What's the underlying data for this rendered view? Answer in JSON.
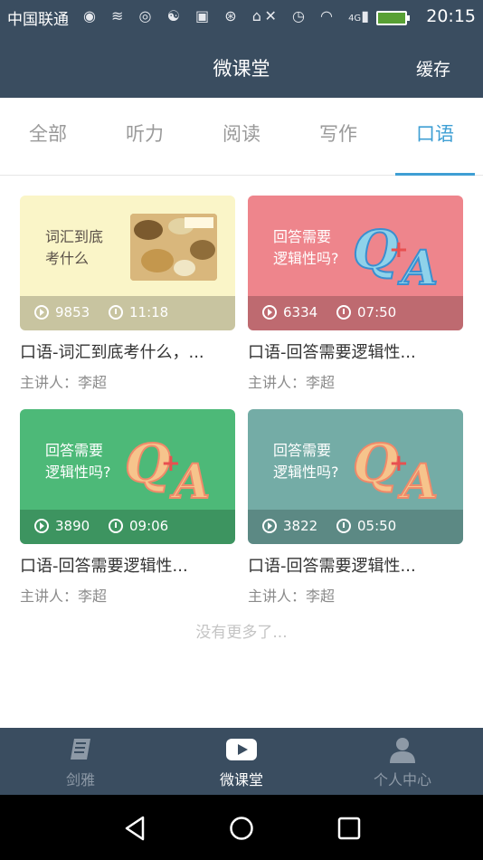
{
  "status": {
    "carrier": "中国联通",
    "network": "4G",
    "time": "20:15"
  },
  "header": {
    "title": "微课堂",
    "cache_label": "缓存"
  },
  "tabs": [
    {
      "label": "全部",
      "active": false
    },
    {
      "label": "听力",
      "active": false
    },
    {
      "label": "阅读",
      "active": false
    },
    {
      "label": "写作",
      "active": false
    },
    {
      "label": "口语",
      "active": true
    }
  ],
  "courses": [
    {
      "thumb_text": [
        "词汇到底",
        "考什么"
      ],
      "thumb_color": "#faf5c8",
      "plays": "9853",
      "duration": "11:18",
      "title": "口语-词汇到底考什么，...",
      "lecturer": "主讲人：李超"
    },
    {
      "thumb_text": [
        "回答需要",
        "逻辑性吗?"
      ],
      "thumb_color": "#ee858c",
      "plays": "6334",
      "duration": "07:50",
      "title": "口语-回答需要逻辑性...",
      "lecturer": "主讲人：李超"
    },
    {
      "thumb_text": [
        "回答需要",
        "逻辑性吗?"
      ],
      "thumb_color": "#4db978",
      "plays": "3890",
      "duration": "09:06",
      "title": "口语-回答需要逻辑性...",
      "lecturer": "主讲人：李超"
    },
    {
      "thumb_text": [
        "回答需要",
        "逻辑性吗?"
      ],
      "thumb_color": "#74aca6",
      "plays": "3822",
      "duration": "05:50",
      "title": "口语-回答需要逻辑性...",
      "lecturer": "主讲人：李超"
    }
  ],
  "no_more_text": "没有更多了...",
  "bottom_nav": [
    {
      "label": "剑雅",
      "icon": "book-icon",
      "active": false
    },
    {
      "label": "微课堂",
      "icon": "play-icon",
      "active": true
    },
    {
      "label": "个人中心",
      "icon": "person-icon",
      "active": false
    }
  ],
  "colors": {
    "header_bg": "#3a4d60",
    "accent": "#3f9fd4"
  }
}
